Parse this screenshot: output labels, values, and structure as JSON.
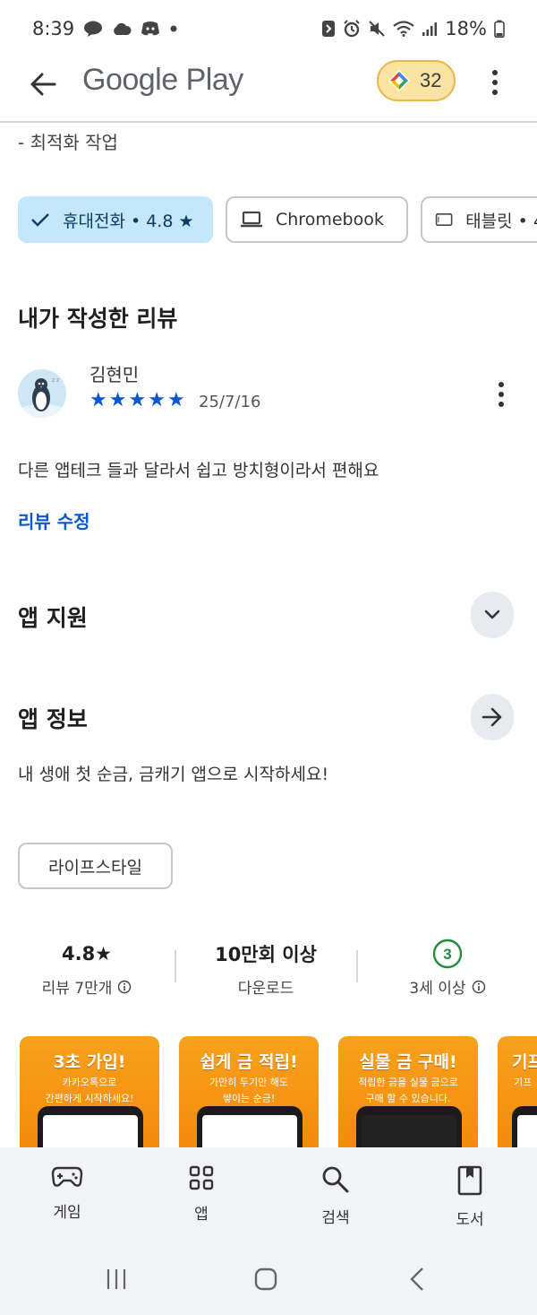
{
  "status_bar": {
    "time": "8:39",
    "battery": "18%"
  },
  "app_bar": {
    "title": "Google Play",
    "points": "32"
  },
  "whats_new": {
    "line": "- 최적화 작업"
  },
  "device_chips": [
    {
      "label": "휴대전화 • 4.8 ★",
      "active": true
    },
    {
      "label": "Chromebook",
      "active": false
    },
    {
      "label": "태블릿 • 4",
      "active": false
    }
  ],
  "my_review": {
    "section_title": "내가 작성한 리뷰",
    "reviewer_name": "김현민",
    "rating": 5,
    "date": "25/7/16",
    "text": "다른 앱테크 들과 달라서 쉽고 방치형이라서 편해요",
    "edit_label": "리뷰 수정"
  },
  "app_support": {
    "title": "앱 지원"
  },
  "app_info": {
    "title": "앱 정보",
    "description": "내 생애 첫 순금, 금캐기 앱으로 시작하세요!",
    "category": "라이프스타일"
  },
  "stats": [
    {
      "top": "4.8★",
      "bottom": "리뷰 7만개"
    },
    {
      "top": "10만회 이상",
      "bottom": "다운로드"
    },
    {
      "top": "3",
      "bottom": "3세 이상"
    }
  ],
  "screenshots": [
    {
      "title": "3초 가입!",
      "sub1": "카카오톡으로",
      "sub2": "간편하게 시작하세요!"
    },
    {
      "title": "쉽게 금 적립!",
      "sub1": "가만히 두기만 해도",
      "sub2": "쌓이는 순금!"
    },
    {
      "title": "실물 금 구매!",
      "sub1": "적립한 금을 실물 금으로",
      "sub2": "구매 할 수 있습니다."
    },
    {
      "title": "기프",
      "sub1": "기프",
      "sub2": ""
    }
  ],
  "bottom_nav": [
    {
      "label": "게임",
      "icon": "gamepad-icon"
    },
    {
      "label": "앱",
      "icon": "apps-grid-icon"
    },
    {
      "label": "검색",
      "icon": "search-icon"
    },
    {
      "label": "도서",
      "icon": "book-icon"
    }
  ],
  "colors": {
    "accent": "#0b57d0",
    "chip_active_bg": "#c4e7fb",
    "points_bg": "#fbe3a4",
    "rating_green": "#1e8e3e",
    "shot_orange": "#f59a16"
  }
}
